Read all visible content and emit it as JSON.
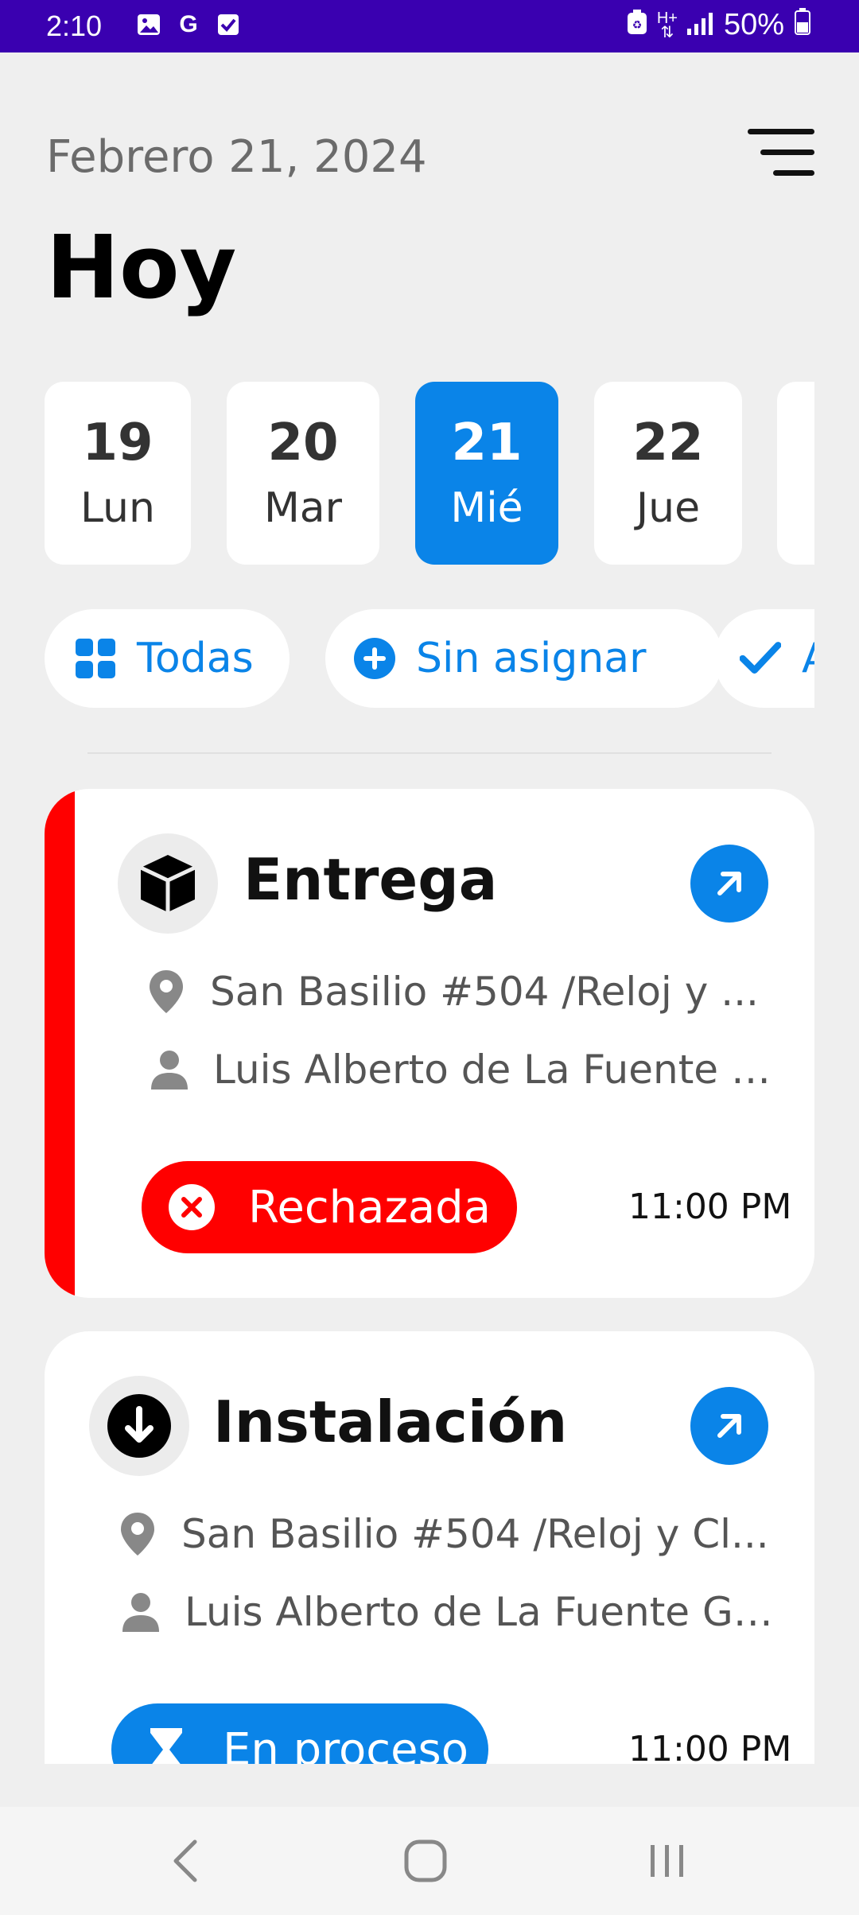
{
  "status_bar": {
    "time": "2:10",
    "notification_icons": [
      "image-icon",
      "google-icon",
      "check-box-icon"
    ],
    "right_icons": [
      "recycle-icon",
      "h-plus-data-icon",
      "signal-icon"
    ],
    "battery": "50%"
  },
  "header": {
    "date": "Febrero 21, 2024",
    "title": "Hoy",
    "menu_icon": "menu-lines-icon"
  },
  "days": [
    {
      "num": "19",
      "dow": "Lun",
      "active": false
    },
    {
      "num": "20",
      "dow": "Mar",
      "active": false
    },
    {
      "num": "21",
      "dow": "Mié",
      "active": true
    },
    {
      "num": "22",
      "dow": "Jue",
      "active": false
    },
    {
      "num": "",
      "dow": "",
      "active": false
    }
  ],
  "filters": [
    {
      "label": "Todas",
      "icon": "grid-icon"
    },
    {
      "label": "Sin asignar",
      "icon": "plus-circle-icon"
    },
    {
      "label": "A",
      "icon": "check-icon"
    }
  ],
  "cards": [
    {
      "title": "Entrega",
      "type_icon": "box-icon",
      "address": "San Basilio #504 /Reloj y ...",
      "person": "Luis Alberto de La Fuente G...",
      "status": "Rechazada",
      "status_icon": "x-circle-icon",
      "status_color": "#ff0000",
      "time": "11:00 PM",
      "accent_color": "#ff0000"
    },
    {
      "title": "Instalación",
      "type_icon": "download-circle-icon",
      "address": "San Basilio #504 /Reloj y Cl...",
      "person": "Luis Alberto de La Fuente Ga...",
      "status": "En proceso",
      "status_icon": "hourglass-icon",
      "status_color": "#0a84e8",
      "time": "11:00 PM"
    }
  ],
  "nav_bar": {
    "back_icon": "back-chevron-icon",
    "home_icon": "home-icon",
    "recents_icon": "recents-icon"
  },
  "colors": {
    "accent": "#0a84e8",
    "status_bar": "#3a00b0",
    "rejected": "#ff0000",
    "background": "#efefef"
  }
}
